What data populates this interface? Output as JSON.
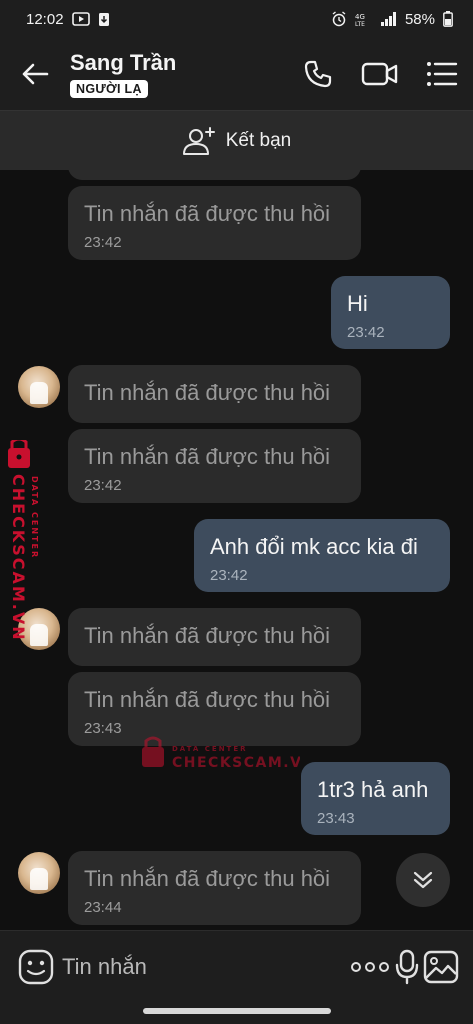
{
  "status_bar": {
    "time": "12:02",
    "battery": "58%",
    "network": "4G"
  },
  "header": {
    "contact_name": "Sang Trần",
    "contact_badge": "NGƯỜI LẠ",
    "icons": [
      "back-arrow-icon",
      "phone-icon",
      "video-camera-icon",
      "menu-list-icon"
    ]
  },
  "add_friend": {
    "label": "Kết bạn"
  },
  "messages": [
    {
      "direction": "in",
      "text": "Tin nhắn đã được thu hồi",
      "time": "23:42",
      "recalled": true,
      "avatar": false
    },
    {
      "direction": "out",
      "text": "Hi",
      "time": "23:42"
    },
    {
      "direction": "in",
      "text": "Tin nhắn đã được thu hồi",
      "time": "",
      "recalled": true,
      "avatar": true
    },
    {
      "direction": "in",
      "text": "Tin nhắn đã được thu hồi",
      "time": "23:42",
      "recalled": true,
      "avatar": false
    },
    {
      "direction": "out",
      "text": "Anh đổi mk acc kia đi",
      "time": "23:42"
    },
    {
      "direction": "in",
      "text": "Tin nhắn đã được thu hồi",
      "time": "",
      "recalled": true,
      "avatar": true
    },
    {
      "direction": "in",
      "text": "Tin nhắn đã được thu hồi",
      "time": "23:43",
      "recalled": true,
      "avatar": false
    },
    {
      "direction": "out",
      "text": "1tr3 hả anh",
      "time": "23:43"
    },
    {
      "direction": "in",
      "text": "Tin nhắn đã được thu hồi",
      "time": "23:44",
      "recalled": true,
      "avatar": true
    }
  ],
  "watermark": {
    "vertical_main": "CHECKSCAM.VN",
    "vertical_sub": "DATA CENTER",
    "horizontal_sub": "DATA CENTER",
    "horizontal_main": "CHECKSCAM.VN"
  },
  "input_bar": {
    "placeholder": "Tin nhắn",
    "icons": [
      "emoji-icon",
      "more-dots-icon",
      "microphone-icon",
      "image-gallery-icon"
    ]
  },
  "colors": {
    "background": "#101010",
    "header": "#1e1e1e",
    "incoming_bubble": "#2b2b2b",
    "outgoing_bubble": "#3e4c5d",
    "watermark": "#c8102e"
  }
}
